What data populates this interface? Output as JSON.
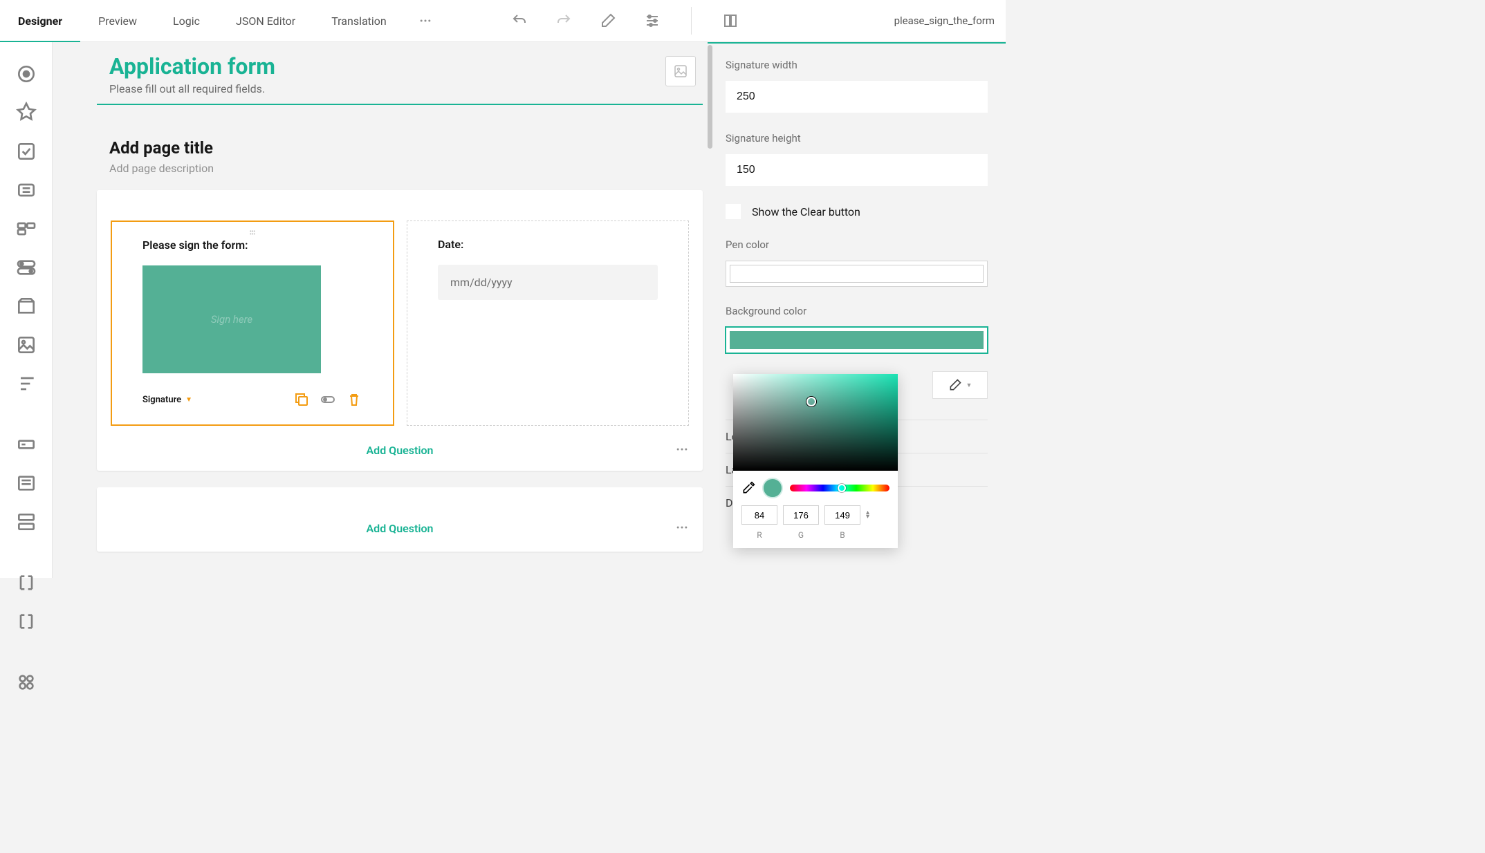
{
  "tabs": {
    "designer": "Designer",
    "preview": "Preview",
    "logic": "Logic",
    "json": "JSON Editor",
    "translation": "Translation"
  },
  "surveyName": "please_sign_the_form",
  "survey": {
    "title": "Application form",
    "description": "Please fill out all required fields."
  },
  "page": {
    "titlePlaceholder": "Add page title",
    "descPlaceholder": "Add page description"
  },
  "questions": {
    "sign": {
      "title": "Please sign the form:",
      "padPlaceholder": "Sign here",
      "typeLabel": "Signature"
    },
    "date": {
      "title": "Date:",
      "placeholder": "mm/dd/yyyy"
    }
  },
  "addQuestion": "Add Question",
  "props": {
    "sigWidthLabel": "Signature width",
    "sigWidth": "250",
    "sigHeightLabel": "Signature height",
    "sigHeight": "150",
    "showClear": "Show the Clear button",
    "penColorLabel": "Pen color",
    "penColor": "#ffffff",
    "bgColorLabel": "Background color",
    "bgColor": "#54B095",
    "accordion": {
      "lo": "Lo",
      "la": "La",
      "data": "Data"
    }
  },
  "picker": {
    "r": "84",
    "g": "176",
    "b": "149",
    "rLab": "R",
    "gLab": "G",
    "bLab": "B"
  }
}
